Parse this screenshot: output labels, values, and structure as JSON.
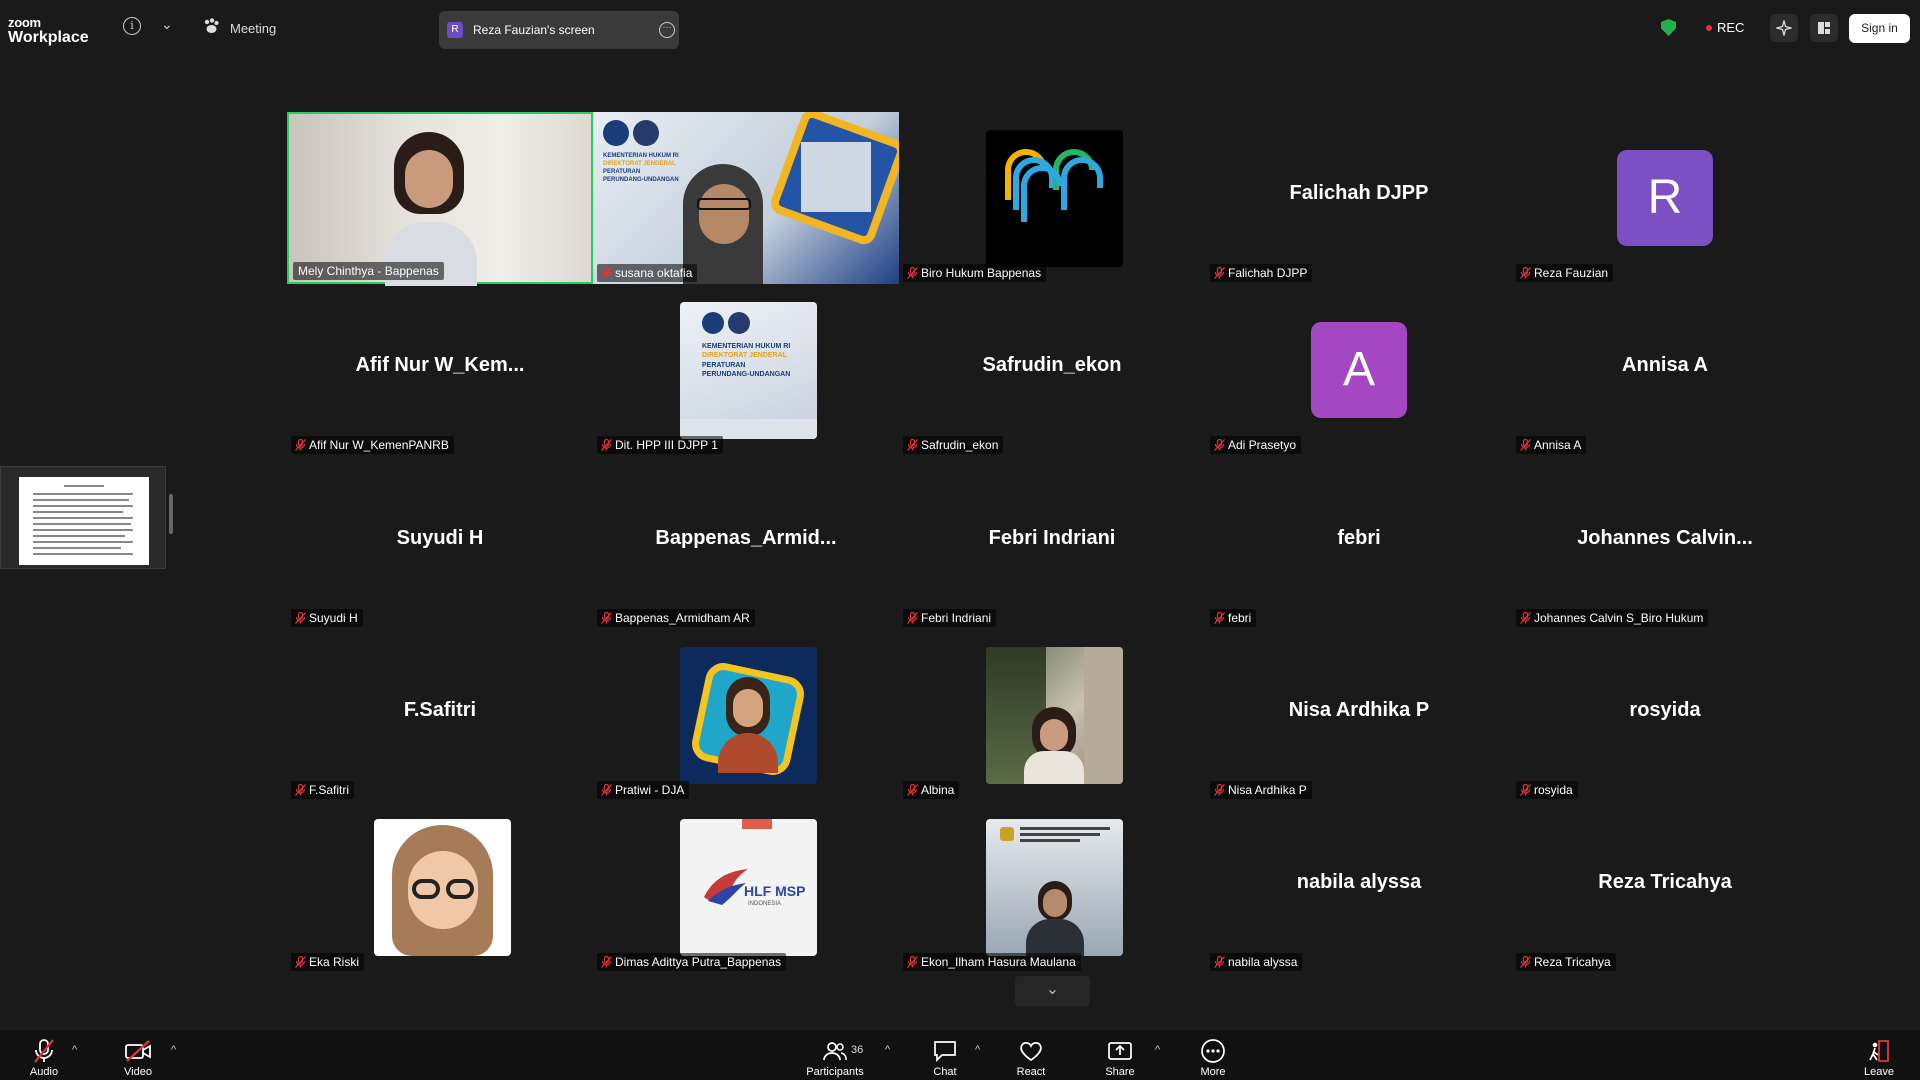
{
  "topbar": {
    "logo_small": "zoom",
    "logo_big": "Workplace",
    "meeting_label": "Meeting",
    "screen_initial": "R",
    "screen_label": "Reza Fauzian's screen",
    "rec_label": "REC",
    "signin_label": "Sign in"
  },
  "tiles": [
    {
      "label": "Mely Chinthya - Bappenas"
    },
    {
      "label": "susana oktafia"
    },
    {
      "label": "Biro Hukum Bappenas"
    },
    {
      "label": "Falichah DJPP",
      "big": "Falichah DJPP"
    },
    {
      "label": "Reza Fauzian",
      "letter": "R",
      "color": "#7c4fc2"
    },
    {
      "label": "Afif Nur W_KemenPANRB",
      "big": "Afif  Nur  W_Kem..."
    },
    {
      "label": "Dit. HPP III DJPP 1"
    },
    {
      "label": "Safrudin_ekon",
      "big": "Safrudin_ekon"
    },
    {
      "label": "Adi Prasetyo",
      "letter": "A",
      "color": "#a348c2"
    },
    {
      "label": "Annisa A",
      "big": "Annisa A"
    },
    {
      "label": "Suyudi H",
      "big": "Suyudi H"
    },
    {
      "label": "Bappenas_Armidham AR",
      "big": "Bappenas_Armid..."
    },
    {
      "label": "Febri Indriani",
      "big": "Febri Indriani"
    },
    {
      "label": "febri",
      "big": "febri"
    },
    {
      "label": "Johannes Calvin S_Biro Hukum",
      "big": "Johannes  Calvin..."
    },
    {
      "label": "F.Safitri",
      "big": "F.Safitri"
    },
    {
      "label": "Pratiwi - DJA"
    },
    {
      "label": "Albina"
    },
    {
      "label": "Nisa Ardhika P",
      "big": "Nisa Ardhika P"
    },
    {
      "label": "rosyida",
      "big": "rosyida"
    },
    {
      "label": "Eka Riski"
    },
    {
      "label": "Dimas Adittya Putra_Bappenas"
    },
    {
      "label": "Ekon_Ilham Hasura Maulana"
    },
    {
      "label": "nabila alyssa",
      "big": "nabila alyssa"
    },
    {
      "label": "Reza Tricahya",
      "big": "Reza Tricahya"
    }
  ],
  "video_text": {
    "djpp_line1": "KEMENTERIAN HUKUM RI",
    "djpp_line2": "DIREKTORAT JENDERAL",
    "djpp_line3": "PERATURAN",
    "djpp_line4": "PERUNDANG-UNDANGAN",
    "hlf": "HLF MSP",
    "hlf_sub": "INDONESIA"
  },
  "toolbar": {
    "audio": "Audio",
    "video": "Video",
    "participants": "Participants",
    "participants_count": "36",
    "chat": "Chat",
    "react": "React",
    "share": "Share",
    "more": "More",
    "leave": "Leave"
  },
  "colors": {
    "active_border": "#23d15c",
    "muted_red": "#e0333c",
    "shield_green": "#23b14d"
  }
}
